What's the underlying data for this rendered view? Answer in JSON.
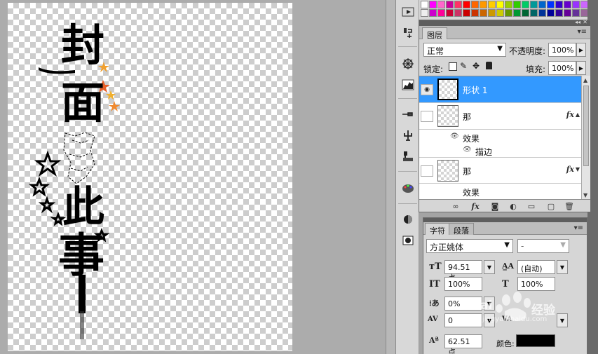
{
  "canvas": {
    "artwork_chars": [
      "封",
      "面",
      "此",
      "事"
    ]
  },
  "toolstrip": {
    "icons": [
      "play-icon",
      "clone-source-icon",
      "navigator-icon",
      "histogram-icon",
      "brush-icon",
      "puppet-icon",
      "stamp-icon",
      "palette-icon",
      "mask-icon",
      "quick-mask-icon"
    ]
  },
  "swatches": {
    "row1": [
      "#ffffff",
      "#ff00ff",
      "#ff66cc",
      "#cc0099",
      "#ff3366",
      "#ff0000",
      "#ff6600",
      "#ff9900",
      "#ffcc00",
      "#ffff00",
      "#99cc00",
      "#33cc00",
      "#00cc66",
      "#009999",
      "#0066cc",
      "#0033ff",
      "#3300cc",
      "#6600cc",
      "#9933ff",
      "#cc66ff"
    ],
    "row2": [
      "#eeeeee",
      "#cc00cc",
      "#ff0099",
      "#cc0033",
      "#cc3366",
      "#cc0000",
      "#cc3300",
      "#cc6600",
      "#cc9900",
      "#cccc00",
      "#669900",
      "#009933",
      "#006633",
      "#006666",
      "#003399",
      "#000099",
      "#330099",
      "#660099",
      "#663399",
      "#996699"
    ]
  },
  "layers_panel": {
    "tabs": [
      "图层"
    ],
    "blend_mode": "正常",
    "opacity_label": "不透明度:",
    "opacity_value": "100%",
    "lock_label": "锁定:",
    "fill_label": "填充:",
    "fill_value": "100%",
    "layers": [
      {
        "name": "形状 1",
        "selected": true,
        "visible": true,
        "has_fx": false
      },
      {
        "name": "那",
        "selected": false,
        "visible": false,
        "has_fx": true,
        "effects_label": "效果",
        "effects": [
          "描边"
        ]
      },
      {
        "name": "那",
        "selected": false,
        "visible": false,
        "has_fx": true,
        "effects_label": "效果",
        "effects": []
      }
    ],
    "fx_text": "fx"
  },
  "character_panel": {
    "tabs": [
      "字符",
      "段落"
    ],
    "font_family": "方正姚体",
    "font_style": "-",
    "font_size": "94.51 点",
    "leading": "(自动)",
    "vertical_scale": "100%",
    "horizontal_scale": "100%",
    "tsume": "0%",
    "tracking": "0",
    "baseline_shift": "62.51 点",
    "color_label": "颜色:",
    "text_color": "#000000"
  }
}
